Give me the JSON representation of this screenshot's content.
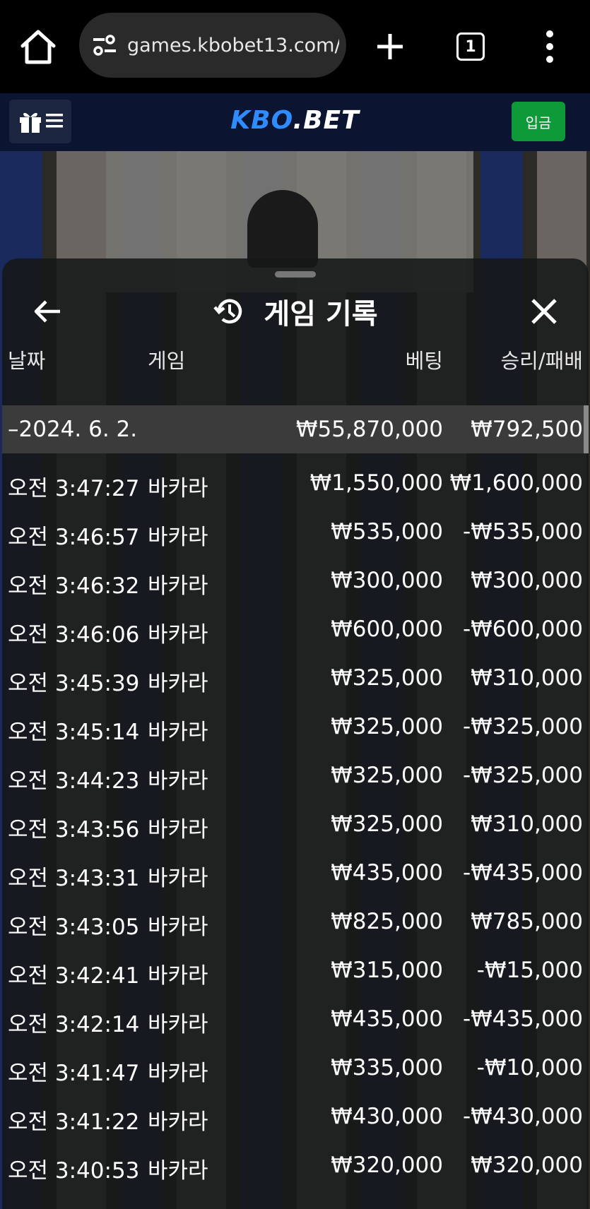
{
  "browser": {
    "url": "games.kbobet13.com/",
    "tab_count": "1"
  },
  "site": {
    "logo_main": "KBO",
    "logo_dot": ".BET",
    "deposit_label": "입금"
  },
  "sheet": {
    "title": "게임 기록",
    "columns": {
      "date": "날짜",
      "game": "게임",
      "bet": "베팅",
      "win_loss": "승리/패배"
    },
    "group": {
      "date": "–2024. 6. 2.",
      "bet": "₩55,870,000",
      "win_loss": "₩792,500"
    },
    "rows": [
      {
        "time": "오전 3:47:27",
        "game": "바카라",
        "bet": "₩1,550,000",
        "win_loss": "₩1,600,000"
      },
      {
        "time": "오전 3:46:57",
        "game": "바카라",
        "bet": "₩535,000",
        "win_loss": "-₩535,000"
      },
      {
        "time": "오전 3:46:32",
        "game": "바카라",
        "bet": "₩300,000",
        "win_loss": "₩300,000"
      },
      {
        "time": "오전 3:46:06",
        "game": "바카라",
        "bet": "₩600,000",
        "win_loss": "-₩600,000"
      },
      {
        "time": "오전 3:45:39",
        "game": "바카라",
        "bet": "₩325,000",
        "win_loss": "₩310,000"
      },
      {
        "time": "오전 3:45:14",
        "game": "바카라",
        "bet": "₩325,000",
        "win_loss": "-₩325,000"
      },
      {
        "time": "오전 3:44:23",
        "game": "바카라",
        "bet": "₩325,000",
        "win_loss": "-₩325,000"
      },
      {
        "time": "오전 3:43:56",
        "game": "바카라",
        "bet": "₩325,000",
        "win_loss": "₩310,000"
      },
      {
        "time": "오전 3:43:31",
        "game": "바카라",
        "bet": "₩435,000",
        "win_loss": "-₩435,000"
      },
      {
        "time": "오전 3:43:05",
        "game": "바카라",
        "bet": "₩825,000",
        "win_loss": "₩785,000"
      },
      {
        "time": "오전 3:42:41",
        "game": "바카라",
        "bet": "₩315,000",
        "win_loss": "-₩15,000"
      },
      {
        "time": "오전 3:42:14",
        "game": "바카라",
        "bet": "₩435,000",
        "win_loss": "-₩435,000"
      },
      {
        "time": "오전 3:41:47",
        "game": "바카라",
        "bet": "₩335,000",
        "win_loss": "-₩10,000"
      },
      {
        "time": "오전 3:41:22",
        "game": "바카라",
        "bet": "₩430,000",
        "win_loss": "-₩430,000"
      },
      {
        "time": "오전 3:40:53",
        "game": "바카라",
        "bet": "₩320,000",
        "win_loss": "₩320,000"
      }
    ]
  },
  "icons": {
    "home": "home-icon",
    "tune": "site-settings-icon",
    "plus": "new-tab-icon",
    "menu": "more-vert-icon",
    "gift": "gift-icon",
    "hamburger": "menu-icon",
    "back": "arrow-left-icon",
    "history": "history-icon",
    "close": "close-icon"
  },
  "colors": {
    "brand_blue": "#2f8cff",
    "deposit_green": "#0f9a3a",
    "header_bg": "#0b1430"
  }
}
